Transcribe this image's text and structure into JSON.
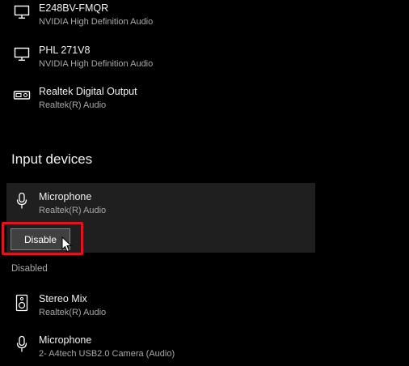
{
  "output_devices": [
    {
      "name": "E248BV-FMQR",
      "driver": "NVIDIA High Definition Audio",
      "icon": "monitor-icon"
    },
    {
      "name": "PHL 271V8",
      "driver": "NVIDIA High Definition Audio",
      "icon": "monitor-icon"
    },
    {
      "name": "Realtek Digital Output",
      "driver": "Realtek(R) Audio",
      "icon": "digital-output-icon"
    }
  ],
  "input": {
    "title": "Input devices",
    "selected_device": {
      "name": "Microphone",
      "driver": "Realtek(R) Audio",
      "icon": "microphone-icon"
    },
    "disable_label": "Disable"
  },
  "disabled": {
    "label": "Disabled",
    "devices": [
      {
        "name": "Stereo Mix",
        "driver": "Realtek(R) Audio",
        "icon": "speaker-icon"
      },
      {
        "name": "Microphone",
        "driver": "2- A4tech USB2.0 Camera (Audio)",
        "icon": "microphone-icon"
      }
    ]
  },
  "colors": {
    "background": "#000000",
    "panel": "#1f1f1f",
    "highlight": "#e0141f",
    "secondary_text": "#a8a8a8"
  }
}
